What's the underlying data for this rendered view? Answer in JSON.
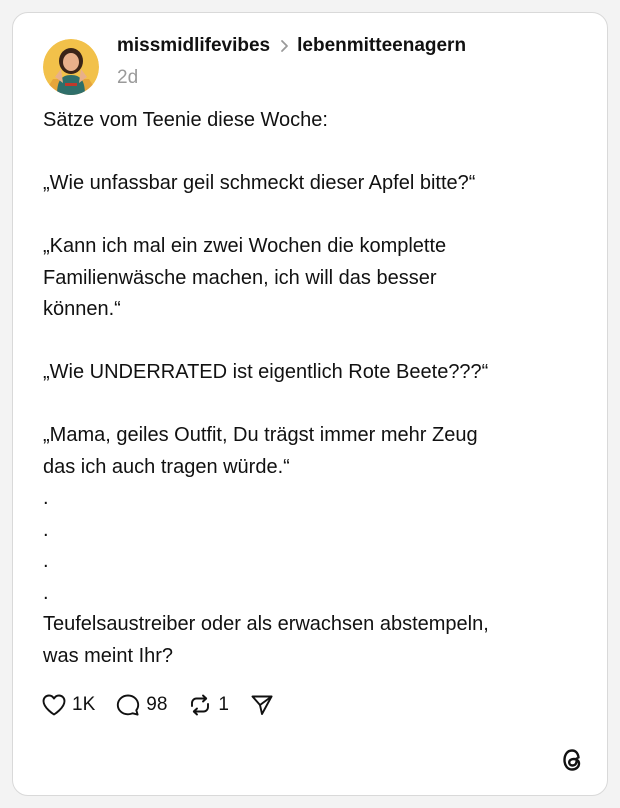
{
  "post": {
    "author": "missmidlifevibes",
    "community": "lebenmitteenagern",
    "timestamp": "2d",
    "lines": [
      "Sätze vom Teenie diese Woche:",
      "",
      "„Wie unfassbar geil schmeckt dieser Apfel bitte?“",
      "",
      "„Kann ich mal ein zwei Wochen die komplette",
      "Familienwäsche machen, ich will das besser",
      "können.“",
      "",
      "„Wie UNDERRATED ist eigentlich Rote Beete???“",
      "",
      "„Mama, geiles Outfit, Du trägst immer mehr Zeug",
      "das ich auch tragen würde.“",
      ".",
      ".",
      ".",
      ".",
      "Teufelsaustreiber oder als erwachsen abstempeln,",
      "was meint Ihr?"
    ]
  },
  "actions": {
    "likes": "1K",
    "replies": "98",
    "reposts": "1"
  },
  "icons": {
    "avatar": "avatar",
    "chevron": "chevron-right-icon",
    "like": "heart-icon",
    "reply": "comment-icon",
    "repost": "repost-icon",
    "share": "send-icon",
    "brand": "threads-logo-icon"
  },
  "colors": {
    "background": "#f3f3f3",
    "card": "#ffffff",
    "text": "#111111",
    "muted": "#9a9a9a"
  }
}
